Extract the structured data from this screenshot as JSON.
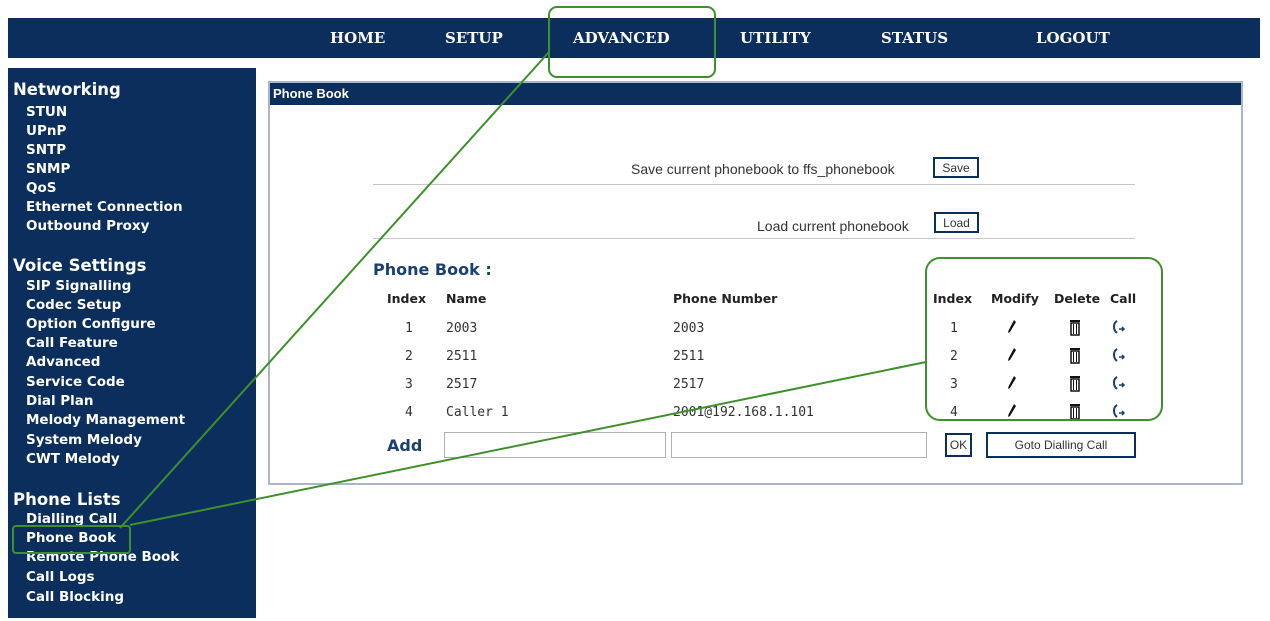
{
  "nav": {
    "home": "HOME",
    "setup": "SETUP",
    "advanced": "ADVANCED",
    "utility": "UTILITY",
    "status": "STATUS",
    "logout": "LOGOUT"
  },
  "sidebar": {
    "networking": {
      "title": "Networking",
      "items": [
        "STUN",
        "UPnP",
        "SNTP",
        "SNMP",
        "QoS",
        "Ethernet Connection",
        "Outbound Proxy"
      ]
    },
    "voice": {
      "title": "Voice Settings",
      "items": [
        "SIP Signalling",
        "Codec Setup",
        "Option Configure",
        "Call Feature",
        "Advanced",
        "Service Code",
        "Dial Plan",
        "Melody Management",
        "System Melody",
        "CWT Melody"
      ]
    },
    "phone_lists": {
      "title": "Phone Lists",
      "items": [
        "Dialling Call",
        "Phone Book",
        "Remote Phone Book",
        "Call Logs",
        "Call Blocking"
      ],
      "selected": "Phone Book"
    }
  },
  "panel": {
    "title": "Phone Book",
    "save_text": "Save current phonebook to ffs_phonebook",
    "save_button": "Save",
    "load_text": "Load current phonebook",
    "load_button": "Load",
    "section_title": "Phone Book :",
    "columns": {
      "index": "Index",
      "name": "Name",
      "phone": "Phone Number",
      "index2": "Index",
      "modify": "Modify",
      "delete": "Delete",
      "call": "Call"
    },
    "rows": [
      {
        "index": "1",
        "name": "2003",
        "phone": "2003",
        "index2": "1"
      },
      {
        "index": "2",
        "name": "2511",
        "phone": "2511",
        "index2": "2"
      },
      {
        "index": "3",
        "name": "2517",
        "phone": "2517",
        "index2": "3"
      },
      {
        "index": "4",
        "name": "Caller 1",
        "phone": "2001@192.168.1.101",
        "index2": "4"
      }
    ],
    "add_label": "Add",
    "add_name_value": "",
    "add_phone_value": "",
    "ok_button": "OK",
    "goto_button": "Goto Dialling Call"
  },
  "icons": {
    "modify": "pencil-icon",
    "delete": "trash-icon",
    "call": "phone-call-icon"
  },
  "colors": {
    "navy": "#0b2e5c",
    "annotation_green": "#3f8f2c"
  }
}
